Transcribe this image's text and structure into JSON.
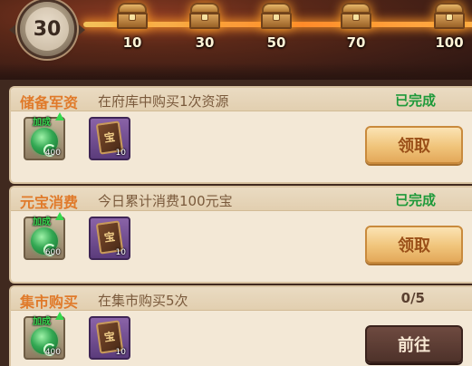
{
  "header": {
    "level": "30",
    "milestones": [
      {
        "label": "10",
        "reached": true
      },
      {
        "label": "30",
        "reached": true
      },
      {
        "label": "50",
        "reached": false
      },
      {
        "label": "70",
        "reached": false
      },
      {
        "label": "100",
        "reached": false
      }
    ]
  },
  "tasks": [
    {
      "name": "储备军资",
      "desc": "在府库中购买1次资源",
      "status": "已完成",
      "rewards": [
        {
          "icon": "jade-icon",
          "bonus": "加成",
          "count": "400"
        },
        {
          "icon": "card-icon",
          "glyph": "宝",
          "count": "10"
        }
      ],
      "button": "领取"
    },
    {
      "name": "元宝消费",
      "desc": "今日累计消费100元宝",
      "status": "已完成",
      "rewards": [
        {
          "icon": "jade-icon",
          "bonus": "加成",
          "count": "600"
        },
        {
          "icon": "card-icon",
          "glyph": "宝",
          "count": "10"
        }
      ],
      "button": "领取"
    },
    {
      "name": "集市购买",
      "desc": "在集市购买5次",
      "status": "0/5",
      "rewards": [
        {
          "icon": "jade-icon",
          "bonus": "加成",
          "count": "400"
        },
        {
          "icon": "card-icon",
          "glyph": "宝",
          "count": "10"
        }
      ],
      "button": "前往"
    }
  ],
  "colors": {
    "task_name": "#e07a2a",
    "status_done": "#1e9a3a",
    "claim_button": "#f0c47a",
    "go_button": "#4e322a"
  }
}
